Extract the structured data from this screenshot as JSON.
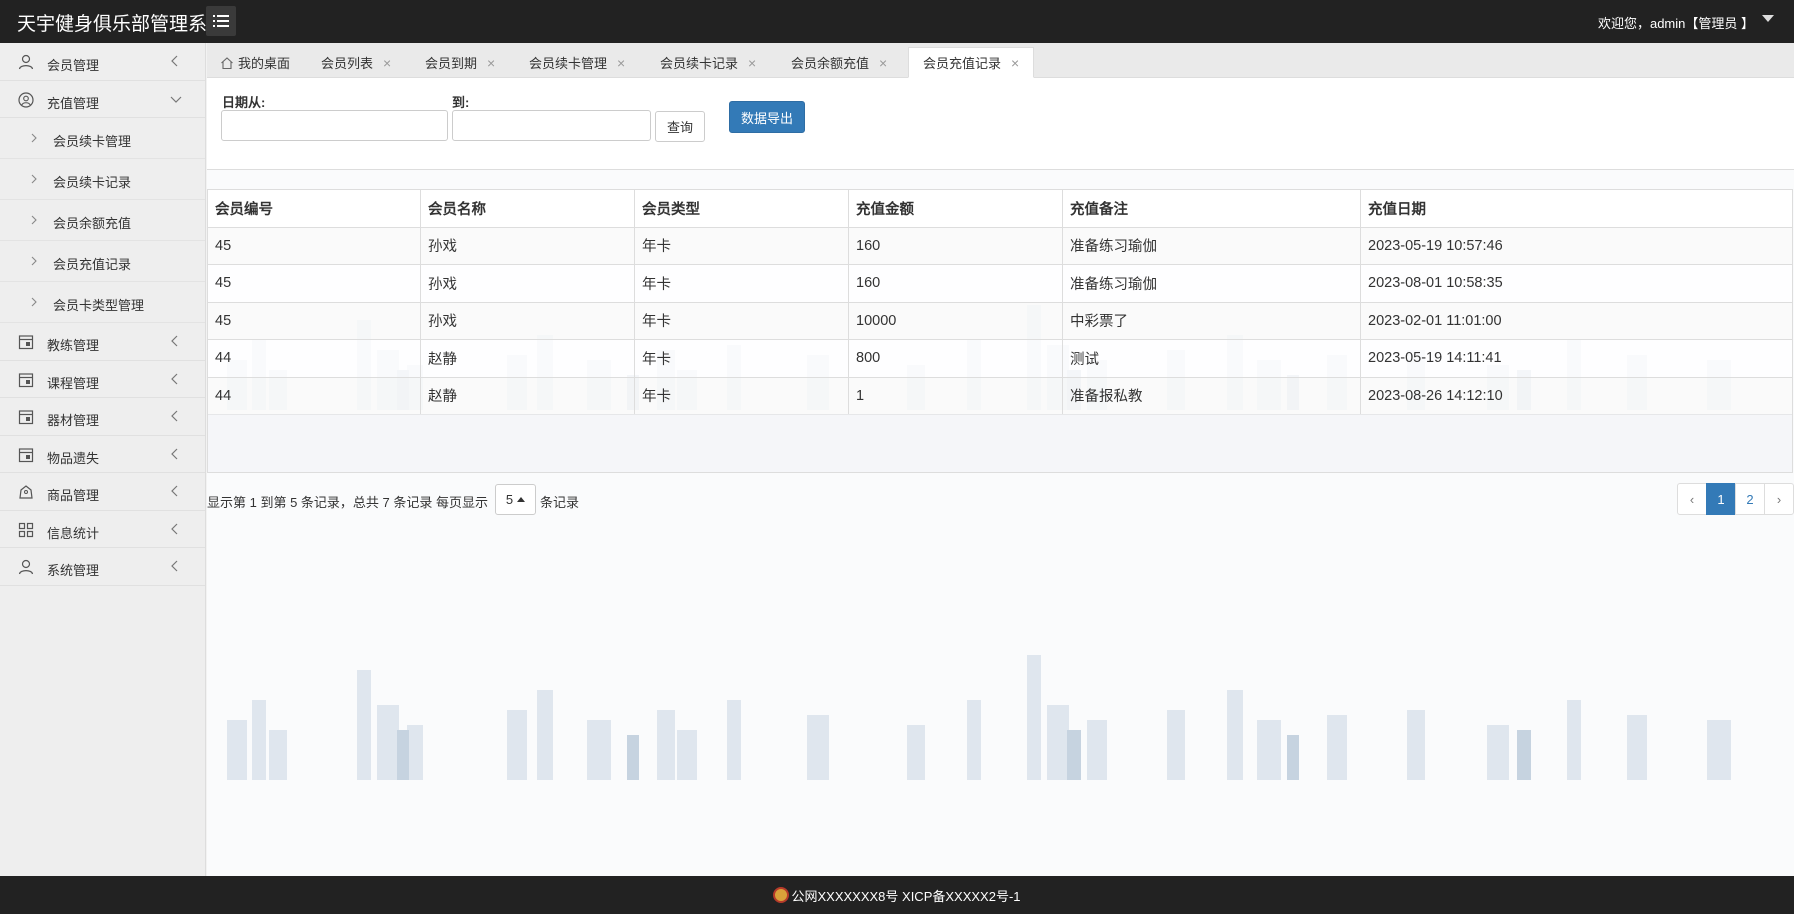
{
  "header": {
    "app_title": "天宇健身俱乐部管理系统",
    "welcome": "欢迎您，admin【管理员 】"
  },
  "sidebar": {
    "items": [
      {
        "label": "会员管理",
        "icon": "user-icon"
      },
      {
        "label": "充值管理",
        "icon": "user-circle-icon",
        "expanded": true,
        "children": [
          "会员续卡管理",
          "会员续卡记录",
          "会员余额充值",
          "会员充值记录",
          "会员卡类型管理"
        ]
      },
      {
        "label": "教练管理",
        "icon": "calendar-icon"
      },
      {
        "label": "课程管理",
        "icon": "calendar-icon"
      },
      {
        "label": "器材管理",
        "icon": "calendar-icon"
      },
      {
        "label": "物品遗失",
        "icon": "calendar-icon"
      },
      {
        "label": "商品管理",
        "icon": "bag-icon"
      },
      {
        "label": "信息统计",
        "icon": "grid-icon"
      },
      {
        "label": "系统管理",
        "icon": "user-icon"
      }
    ]
  },
  "tabs": [
    {
      "label": "我的桌面",
      "closable": false,
      "icon": "home-icon"
    },
    {
      "label": "会员列表",
      "closable": true
    },
    {
      "label": "会员到期",
      "closable": true
    },
    {
      "label": "会员续卡管理",
      "closable": true
    },
    {
      "label": "会员续卡记录",
      "closable": true
    },
    {
      "label": "会员余额充值",
      "closable": true
    },
    {
      "label": "会员充值记录",
      "closable": true,
      "active": true
    }
  ],
  "filter": {
    "date_from_label": "日期从:",
    "date_to_label": "到:",
    "date_from_value": "",
    "date_to_value": "",
    "query_button": "查询",
    "export_button": "数据导出"
  },
  "table": {
    "headers": [
      "会员编号",
      "会员名称",
      "会员类型",
      "充值金额",
      "充值备注",
      "充值日期"
    ],
    "rows": [
      [
        "45",
        "孙戏",
        "年卡",
        "160",
        "准备练习瑜伽",
        "2023-05-19 10:57:46"
      ],
      [
        "45",
        "孙戏",
        "年卡",
        "160",
        "准备练习瑜伽",
        "2023-08-01 10:58:35"
      ],
      [
        "45",
        "孙戏",
        "年卡",
        "10000",
        "中彩票了",
        "2023-02-01 11:01:00"
      ],
      [
        "44",
        "赵静",
        "年卡",
        "800",
        "测试",
        "2023-05-19 14:11:41"
      ],
      [
        "44",
        "赵静",
        "年卡",
        "1",
        "准备报私教",
        "2023-08-26 14:12:10"
      ]
    ]
  },
  "pagination": {
    "info": "显示第 1 到第 5 条记录，总共 7 条记录 每页显示",
    "page_size": "5",
    "suffix": "条记录",
    "prev": "‹",
    "pages": [
      "1",
      "2"
    ],
    "next": "›",
    "current": "1"
  },
  "footer": {
    "text": "公网XXXXXXX8号 XICP备XXXXX2号-1"
  },
  "colors": {
    "topbar": "#222222",
    "accent": "#337ab7",
    "sidebar_bg": "#eeeeee"
  }
}
